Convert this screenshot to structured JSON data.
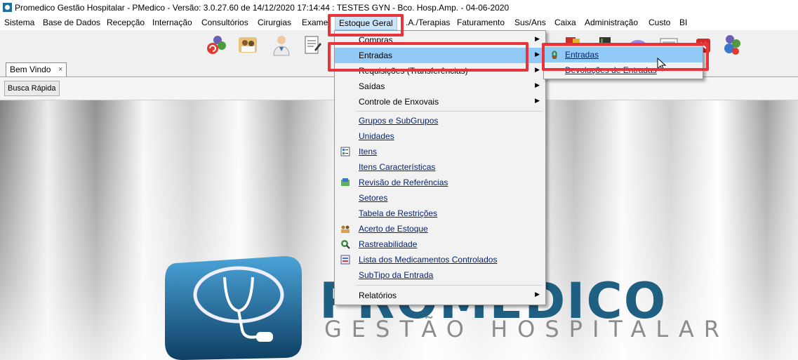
{
  "window": {
    "title": "Promedico Gestão Hospitalar - PMedico - Versão: 3.0.27.60 de 14/12/2020 17:14:44 : TESTES GYN - Bco. Hosp.Amp. - 04-06-2020"
  },
  "menubar": [
    "Sistema",
    "Base de Dados",
    "Recepção",
    "Internação",
    "Consultórios",
    "Cirurgias",
    "Exames",
    "Estoque Geral",
    "S.A.D.T/Terapias",
    "Faturamento",
    "Sus/Ans",
    "Caixa",
    "Administração",
    "Custo",
    "BI"
  ],
  "menubar_visible": {
    "exames": "Exame",
    "terapias": ".A./Terapias"
  },
  "tabs": {
    "welcome": "Bem Vindo",
    "close": "×"
  },
  "quick_search": "Busca Rápida",
  "estoque_menu": {
    "compras": "Compras",
    "entradas": "Entradas",
    "requisicoes": "Requisições (Transferências)",
    "saidas": "Saídas",
    "enxovais": "Controle de Enxovais",
    "grupos": "Grupos e SubGrupos",
    "unidades": "Unidades",
    "itens": "Itens",
    "itens_caracteristicas": "Itens Características",
    "revisao": "Revisão de Referências",
    "setores": "Setores",
    "restricoes": "Tabela de Restrições",
    "acerto": "Acerto de Estoque",
    "rastreabilidade": "Rastreabilidade",
    "controlados": "Lista dos Medicamentos Controlados",
    "subtipo": "SubTipo da Entrada",
    "relatorios": "Relatórios"
  },
  "entradas_submenu": {
    "entradas": "Entradas",
    "devolucoes": "Devoluções de Entradas"
  },
  "logo": {
    "brand": "PROMÉDICO",
    "tagline": "GESTÃO HOSPITALAR"
  },
  "colors": {
    "highlight": "#91c9f7",
    "annotation": "#e8333a",
    "menubar_active": "#cce4f7"
  }
}
